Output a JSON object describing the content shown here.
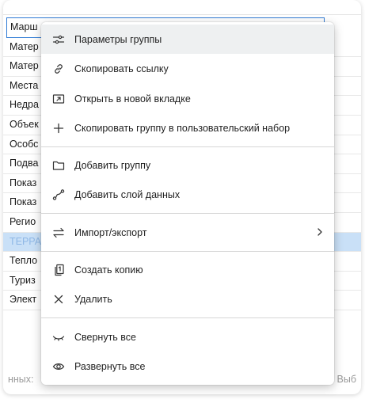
{
  "layers": {
    "rows": [
      "Марш",
      "Матер",
      "Матер",
      "Места",
      "Недра",
      "Объек",
      "Особс",
      "Подва",
      "Показ",
      "Показ",
      "Регио",
      "ТЕРРА",
      "Тепло",
      "Туриз",
      "Элект"
    ]
  },
  "footer": {
    "left": "нных:",
    "right": "Выб"
  },
  "menu": {
    "items": [
      {
        "label": "Параметры группы",
        "icon": "sliders-icon"
      },
      {
        "label": "Скопировать ссылку",
        "icon": "link-icon"
      },
      {
        "label": "Открыть в новой вкладке",
        "icon": "open-in-new-tab-icon"
      },
      {
        "label": "Скопировать группу в пользовательский набор",
        "icon": "plus-icon"
      },
      {
        "label": "Добавить группу",
        "icon": "folder-icon"
      },
      {
        "label": "Добавить слой данных",
        "icon": "route-icon"
      },
      {
        "label": "Импорт/экспорт",
        "icon": "import-export-icon"
      },
      {
        "label": "Создать копию",
        "icon": "copy-icon"
      },
      {
        "label": "Удалить",
        "icon": "close-icon"
      },
      {
        "label": "Свернуть все",
        "icon": "eye-closed-icon"
      },
      {
        "label": "Развернуть все",
        "icon": "eye-icon"
      }
    ],
    "submenu_arrow": "chevron-right-icon"
  },
  "colors": {
    "accent": "#2f7bd5",
    "highlight_row": "#c9e0f7",
    "active_item": "#eef0f1"
  }
}
